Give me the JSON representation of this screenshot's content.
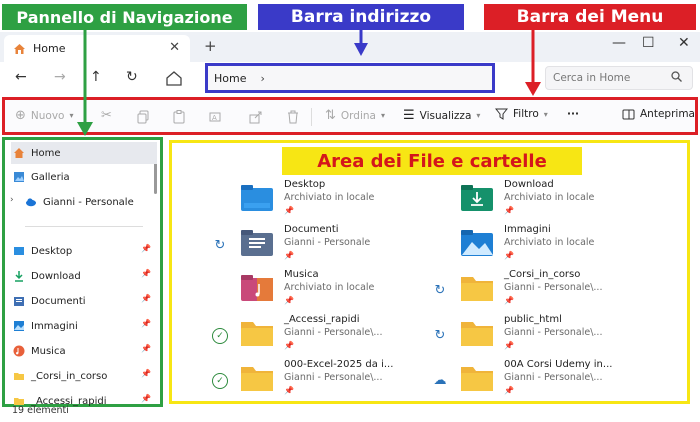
{
  "banners": {
    "navigation": "Pannello di Navigazione",
    "address": "Barra indirizzo",
    "menu": "Barra dei Menu",
    "files": "Area dei File e cartelle"
  },
  "window": {
    "tab_title": "Home",
    "new_tab": "+",
    "close": "✕",
    "minimize": "—",
    "maximize": "☐"
  },
  "nav": {
    "back": "←",
    "forward": "→",
    "up": "↑",
    "refresh": "↻",
    "address_text": "Home",
    "address_chevron": "›",
    "search_placeholder": "Cerca in Home"
  },
  "toolbar": {
    "new_label": "Nuovo",
    "sort_label": "Ordina",
    "view_label": "Visualizza",
    "filter_label": "Filtro",
    "more_label": "···",
    "preview_label": "Anteprima"
  },
  "sidebar": {
    "items": [
      {
        "label": "Home",
        "icon": "home-icon"
      },
      {
        "label": "Galleria",
        "icon": "gallery-icon"
      },
      {
        "label": "Gianni - Personale",
        "icon": "cloud-icon"
      },
      {
        "label": "Desktop",
        "icon": "desktop-icon"
      },
      {
        "label": "Download",
        "icon": "download-icon"
      },
      {
        "label": "Documenti",
        "icon": "documents-icon"
      },
      {
        "label": "Immagini",
        "icon": "pictures-icon"
      },
      {
        "label": "Musica",
        "icon": "music-icon"
      },
      {
        "label": "_Corsi_in_corso",
        "icon": "folder-icon"
      },
      {
        "label": "_Accessi_rapidi",
        "icon": "folder-icon"
      }
    ]
  },
  "files": [
    {
      "name": "Desktop",
      "sub": "Archiviato in locale",
      "icon": "desktop-folder-icon",
      "sync": ""
    },
    {
      "name": "Download",
      "sub": "Archiviato in locale",
      "icon": "download-folder-icon",
      "sync": ""
    },
    {
      "name": "Documenti",
      "sub": "Gianni - Personale",
      "icon": "documents-folder-icon",
      "sync": "sync-icon"
    },
    {
      "name": "Immagini",
      "sub": "Archiviato in locale",
      "icon": "pictures-folder-icon",
      "sync": ""
    },
    {
      "name": "Musica",
      "sub": "Archiviato in locale",
      "icon": "music-folder-icon",
      "sync": ""
    },
    {
      "name": "_Corsi_in_corso",
      "sub": "Gianni - Personale\\...",
      "icon": "folder-icon",
      "sync": "sync-icon"
    },
    {
      "name": "_Accessi_rapidi",
      "sub": "Gianni - Personale\\...",
      "icon": "folder-icon",
      "sync": "synced-check-icon"
    },
    {
      "name": "public_html",
      "sub": "Gianni - Personale\\...",
      "icon": "folder-icon",
      "sync": "sync-icon"
    },
    {
      "name": "000-Excel-2025 da i...",
      "sub": "Gianni - Personale\\...",
      "icon": "folder-icon",
      "sync": "synced-check-icon"
    },
    {
      "name": "00A Corsi Udemy in...",
      "sub": "Gianni - Personale\\...",
      "icon": "folder-icon",
      "sync": "cloud-only-icon"
    }
  ],
  "status": {
    "count": "19 elementi"
  },
  "colors": {
    "nav_green": "#2ea043",
    "address_blue": "#3a3ac8",
    "menu_red": "#dc1f26",
    "files_yellow": "#f7e614",
    "folder_yellow": "#f6c744"
  }
}
